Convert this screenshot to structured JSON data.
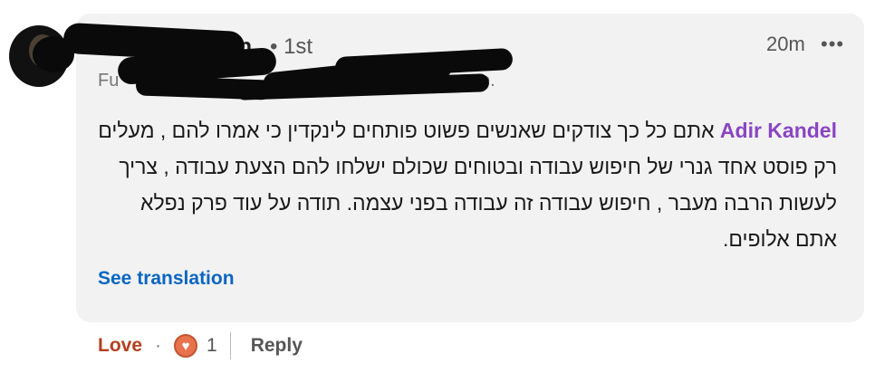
{
  "comment": {
    "author_name": "ion",
    "degree": "• 1st",
    "headline_start": "Fu",
    "headline_end": "e.",
    "time": "20m",
    "more": "•••",
    "mention": "Adir Kandel",
    "text": "אתם כל כך צודקים שאנשים פשוט פותחים לינקדין כי אמרו להם , מעלים רק פוסט אחד גנרי של חיפוש עבודה ובטוחים שכולם ישלחו להם הצעת עבודה , צריך לעשות הרבה מעבר , חיפוש עבודה זה עבודה בפני עצמה. תודה על עוד פרק נפלא אתם אלופים.",
    "see_translation": "See translation"
  },
  "actions": {
    "love_label": "Love",
    "separator": "·",
    "reaction_count": "1",
    "reply_label": "Reply"
  },
  "colors": {
    "bubble": "#f2f2f2",
    "mention": "#8a44c4",
    "link": "#0a66c2",
    "love": "#b24020"
  },
  "icons": {
    "reaction": "heart-reaction-icon",
    "more": "more-options-icon"
  }
}
